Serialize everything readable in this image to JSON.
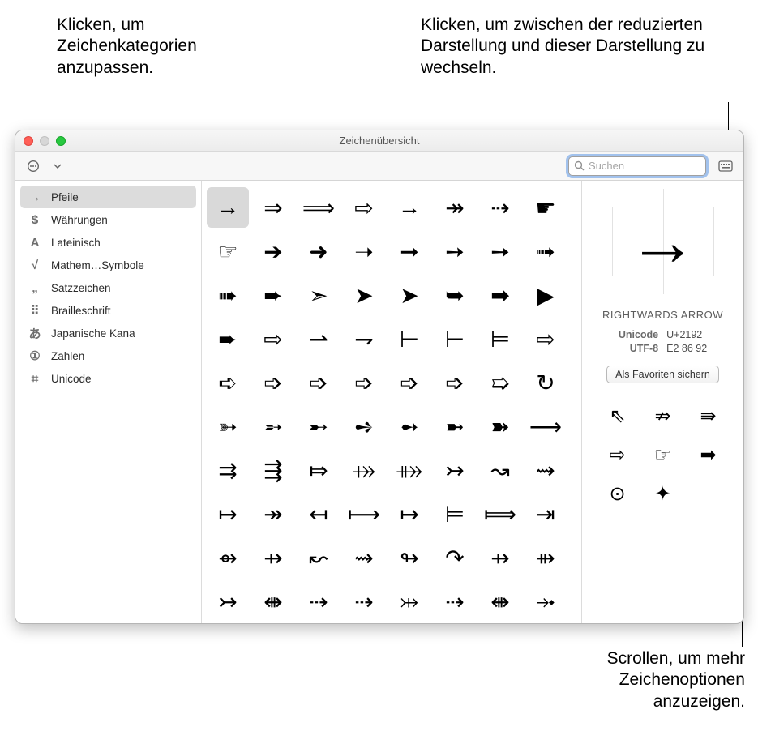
{
  "callouts": {
    "topLeft": "Klicken, um Zeichenkategorien anzupassen.",
    "topRight": "Klicken, um zwischen der reduzierten Darstellung und dieser Darstellung zu wechseln.",
    "bottomRight": "Scrollen, um mehr Zeichenoptionen anzuzeigen."
  },
  "window": {
    "title": "Zeichenübersicht",
    "search_placeholder": "Suchen"
  },
  "sidebar": {
    "items": [
      {
        "icon": "→",
        "label": "Pfeile",
        "selected": true
      },
      {
        "icon": "$",
        "label": "Währungen",
        "selected": false
      },
      {
        "icon": "A",
        "label": "Lateinisch",
        "selected": false
      },
      {
        "icon": "√",
        "label": "Mathem…Symbole",
        "selected": false
      },
      {
        "icon": "„",
        "label": "Satzzeichen",
        "selected": false
      },
      {
        "icon": "⠿",
        "label": "Brailleschrift",
        "selected": false
      },
      {
        "icon": "あ",
        "label": "Japanische Kana",
        "selected": false
      },
      {
        "icon": "①",
        "label": "Zahlen",
        "selected": false
      },
      {
        "icon": "⌗",
        "label": "Unicode",
        "selected": false
      }
    ]
  },
  "grid": {
    "selected_index": 0,
    "chars": [
      "→",
      "⇒",
      "⟹",
      "⇨",
      "→",
      "↠",
      "⇢",
      "☛",
      "☞",
      "➔",
      "➜",
      "➝",
      "➞",
      "➙",
      "➙",
      "➟",
      "➠",
      "➨",
      "➣",
      "➤",
      "➤",
      "➥",
      "➡",
      "▶",
      "➨",
      "⇨",
      "⇀",
      "⇁",
      "⊢",
      "⊢",
      "⊨",
      "⇨",
      "➪",
      "➩",
      "➩",
      "➩",
      "➩",
      "➩",
      "➯",
      "↻",
      "➳",
      "➵",
      "➸",
      "➺",
      "➻",
      "➼",
      "➽",
      "⟶",
      "⇉",
      "⇶",
      "⤇",
      "⤀",
      "⤁",
      "↣",
      "↝",
      "⇝",
      "↦",
      "↠",
      "↤",
      "⟼",
      "↦",
      "⊨",
      "⟾",
      "⇥",
      "⇴",
      "⇸",
      "↜",
      "⇝",
      "↬",
      "↷",
      "⇸",
      "⇻",
      "↣",
      "⇼",
      "⇢",
      "⇢",
      "⤔",
      "⇢",
      "⇼",
      "⤞"
    ]
  },
  "detail": {
    "glyph": "→",
    "name": "RIGHTWARDS ARROW",
    "fields": {
      "unicode_label": "Unicode",
      "unicode_value": "U+2192",
      "utf8_label": "UTF-8",
      "utf8_value": "E2 86 92"
    },
    "favorite_button": "Als Favoriten sichern",
    "variants": [
      "⇖",
      "⇏",
      "⇛",
      "⇨",
      "☞",
      "➡",
      "⊙",
      "✦"
    ]
  }
}
